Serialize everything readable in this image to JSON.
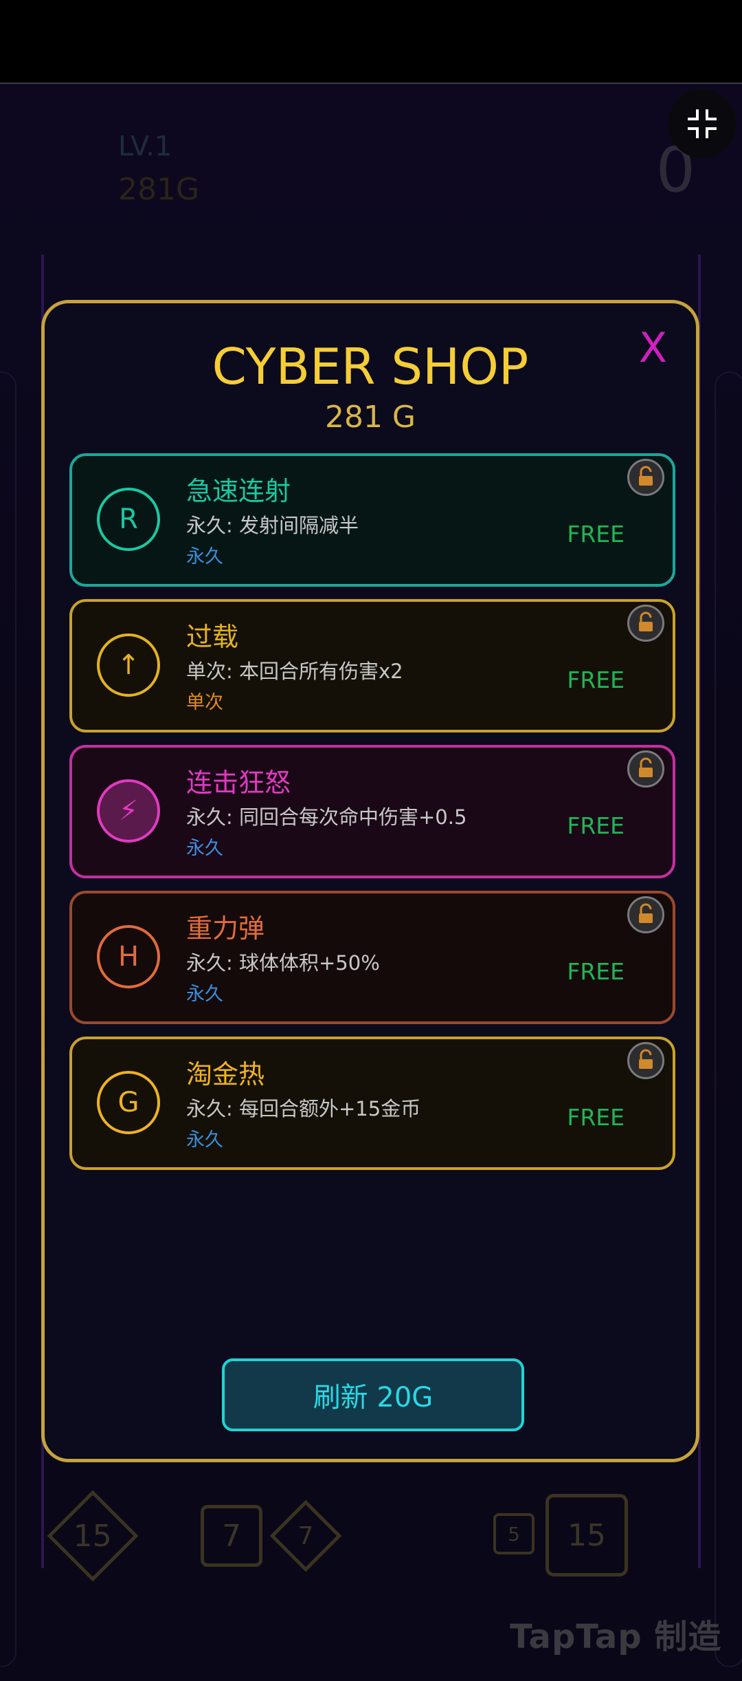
{
  "hud": {
    "level": "LV.1",
    "gold": "281G",
    "score": "0"
  },
  "board": {
    "pieces": [
      "15",
      "7",
      "7",
      "5",
      "15"
    ]
  },
  "watermark": "TapTap 制造",
  "shop": {
    "title": "CYBER SHOP",
    "gold": "281 G",
    "close": "X",
    "refresh": "刷新 20G",
    "items": [
      {
        "icon": "R",
        "name": "急速连射",
        "desc": "永久: 发射间隔减半",
        "tag": "永久",
        "price": "FREE",
        "color": "#19c9a3"
      },
      {
        "icon": "↑",
        "name": "过载",
        "desc": "单次: 本回合所有伤害x2",
        "tag": "单次",
        "price": "FREE",
        "color": "#e4b31e"
      },
      {
        "icon": "⚡",
        "name": "连击狂怒",
        "desc": "永久: 同回合每次命中伤害+0.5",
        "tag": "永久",
        "price": "FREE",
        "color": "#e13ac1"
      },
      {
        "icon": "H",
        "name": "重力弹",
        "desc": "永久: 球体体积+50%",
        "tag": "永久",
        "price": "FREE",
        "color": "#e36b3a"
      },
      {
        "icon": "G",
        "name": "淘金热",
        "desc": "永久: 每回合额外+15金币",
        "tag": "永久",
        "price": "FREE",
        "color": "#eeb321"
      }
    ]
  }
}
